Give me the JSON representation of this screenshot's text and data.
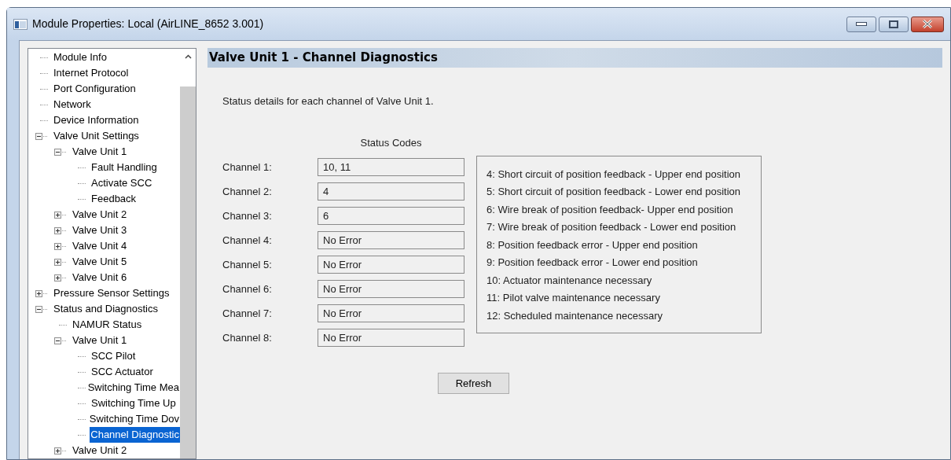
{
  "window": {
    "title": "Module Properties: Local (AirLINE_8652 3.001)"
  },
  "tree": [
    {
      "label": "Module Info",
      "selected": false
    },
    {
      "label": "Internet Protocol",
      "selected": false
    },
    {
      "label": "Port Configuration",
      "selected": false
    },
    {
      "label": "Network",
      "selected": false
    },
    {
      "label": "Device Information",
      "selected": false
    },
    {
      "label": "Valve Unit Settings",
      "selected": false,
      "expanded": true,
      "children": [
        {
          "label": "Valve Unit 1",
          "selected": false,
          "expanded": true,
          "children": [
            {
              "label": "Fault Handling",
              "selected": false
            },
            {
              "label": "Activate SCC",
              "selected": false
            },
            {
              "label": "Feedback",
              "selected": false
            }
          ]
        },
        {
          "label": "Valve Unit 2",
          "selected": false,
          "expanded": false
        },
        {
          "label": "Valve Unit 3",
          "selected": false,
          "expanded": false
        },
        {
          "label": "Valve Unit 4",
          "selected": false,
          "expanded": false
        },
        {
          "label": "Valve Unit 5",
          "selected": false,
          "expanded": false
        },
        {
          "label": "Valve Unit 6",
          "selected": false,
          "expanded": false
        }
      ]
    },
    {
      "label": "Pressure Sensor Settings",
      "selected": false,
      "expanded": false
    },
    {
      "label": "Status and Diagnostics",
      "selected": false,
      "expanded": true,
      "children": [
        {
          "label": "NAMUR Status",
          "selected": false
        },
        {
          "label": "Valve Unit 1",
          "selected": false,
          "expanded": true,
          "children": [
            {
              "label": "SCC Pilot",
              "selected": false
            },
            {
              "label": "SCC Actuator",
              "selected": false
            },
            {
              "label": "Switching Time Mea",
              "selected": false
            },
            {
              "label": "Switching Time Up",
              "selected": false
            },
            {
              "label": "Switching Time Dov",
              "selected": false
            },
            {
              "label": "Channel Diagnostic",
              "selected": true
            }
          ]
        },
        {
          "label": "Valve Unit 2",
          "selected": false,
          "expanded": false
        }
      ]
    }
  ],
  "panel": {
    "title": "Valve Unit 1 - Channel Diagnostics",
    "description": "Status details for each channel of Valve Unit 1.",
    "column_heading": "Status Codes",
    "channels": [
      {
        "label": "Channel 1:",
        "value": "10, 11"
      },
      {
        "label": "Channel 2:",
        "value": "4"
      },
      {
        "label": "Channel 3:",
        "value": "6"
      },
      {
        "label": "Channel 4:",
        "value": "No Error"
      },
      {
        "label": "Channel 5:",
        "value": "No Error"
      },
      {
        "label": "Channel 6:",
        "value": "No Error"
      },
      {
        "label": "Channel 7:",
        "value": "No Error"
      },
      {
        "label": "Channel 8:",
        "value": "No Error"
      }
    ],
    "legend": [
      "4: Short circuit of position feedback - Upper end position",
      "5: Short circuit of position feedback - Lower end position",
      "6: Wire break of position feedback- Upper end position",
      "7: Wire break of position feedback - Lower end position",
      "8: Position feedback error - Upper end position",
      "9: Position feedback error - Lower end position",
      "10: Actuator maintenance necessary",
      "11: Pilot valve maintenance necessary",
      "12: Scheduled maintenance necessary"
    ],
    "button": "Refresh"
  }
}
